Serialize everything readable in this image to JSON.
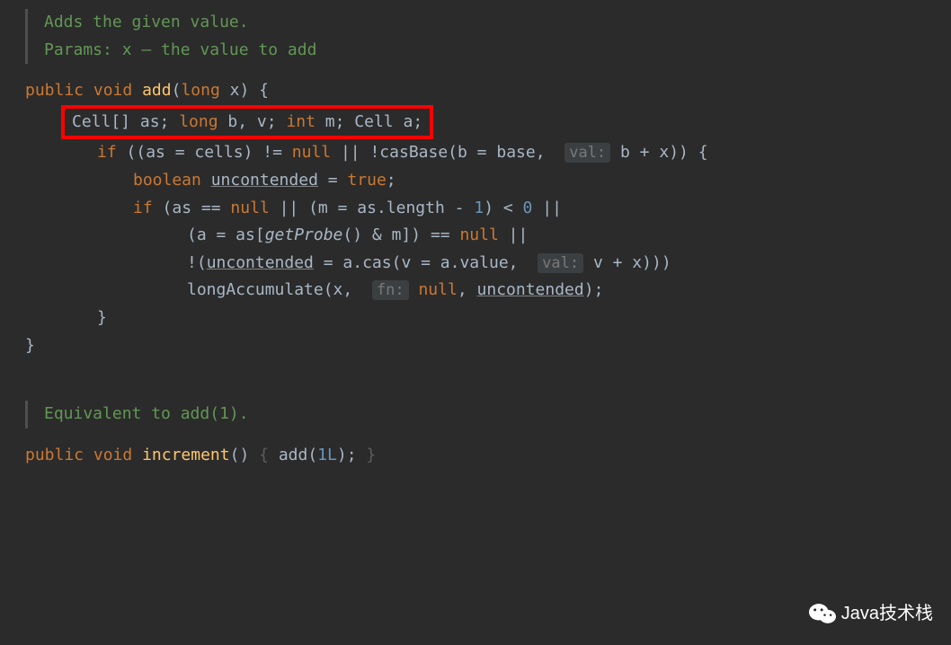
{
  "doc1": {
    "line1": "Adds the given value.",
    "line2": "Params: x – the value to add"
  },
  "sig1": {
    "public": "public",
    "void": "void",
    "add": "add",
    "open": "(",
    "long": "long",
    "x": " x) {"
  },
  "decl": {
    "cell1": "Cell[] as; ",
    "long": "long",
    "bv": " b, v; ",
    "int": "int",
    "m": " m; Cell a;"
  },
  "if1": {
    "if": "if",
    "part1": " ((as = cells) != ",
    "null1": "null",
    "part2": " || !casBase(b = base,  ",
    "hint1": "val:",
    "part3": " b + x)) {"
  },
  "bool": {
    "boolean": "boolean",
    "sp": " ",
    "uncontended": "uncontended",
    "eq": " = ",
    "true": "true",
    "semi": ";"
  },
  "if2": {
    "if": "if",
    "part1": " (as == ",
    "null1": "null",
    "part2": " || (m = as.",
    "length": "length",
    "part3": " - ",
    "one": "1",
    "part4": ") < ",
    "zero": "0",
    "part5": " ||"
  },
  "if3": {
    "part1": "(a = as[",
    "getprobe": "getProbe",
    "part2": "() & m]) == ",
    "null1": "null",
    "part3": " ||"
  },
  "if4": {
    "part1": "!(",
    "uncontended": "uncontended",
    "part2": " = a.cas(v = a.",
    "value": "value",
    "part3": ",  ",
    "hint": "val:",
    "part4": " v + x)))"
  },
  "accum": {
    "fn": "longAccumulate(x,  ",
    "hint": "fn:",
    "sp": " ",
    "null1": "null",
    "comma": ", ",
    "uncontended": "uncontended",
    "close": ");"
  },
  "close1": "}",
  "close2": "}",
  "doc2": {
    "line1_a": "Equivalent to ",
    "line1_b": "add(1)",
    "line1_c": "."
  },
  "sig2": {
    "public": "public",
    "void": "void",
    "increment": "increment",
    "paren": "() ",
    "open": "{",
    "body": " add(",
    "one": "1L",
    "close1": "); ",
    "close2": "}"
  },
  "watermark": "Java技术栈"
}
